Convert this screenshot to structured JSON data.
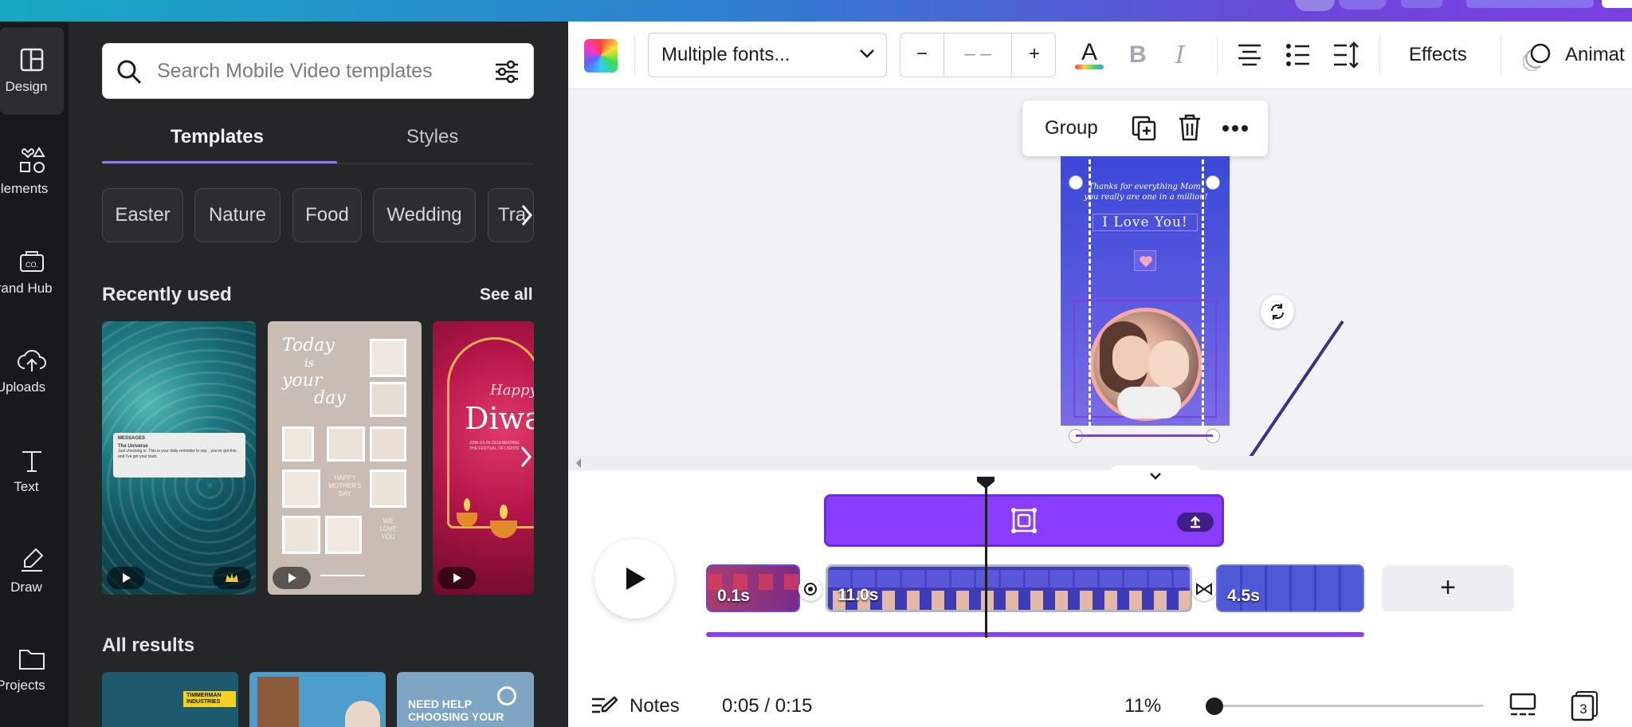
{
  "rail": [
    {
      "label": "Design",
      "icon": "design-icon"
    },
    {
      "label": "Elements",
      "icon": "elements-icon"
    },
    {
      "label": "Brand Hub",
      "icon": "brand-hub-icon"
    },
    {
      "label": "Uploads",
      "icon": "upload-icon"
    },
    {
      "label": "Text",
      "icon": "text-icon"
    },
    {
      "label": "Draw",
      "icon": "draw-icon"
    },
    {
      "label": "Projects",
      "icon": "folder-icon"
    }
  ],
  "search": {
    "placeholder": "Search Mobile Video templates"
  },
  "tabs": {
    "templates": "Templates",
    "styles": "Styles"
  },
  "chips": [
    "Easter",
    "Nature",
    "Food",
    "Wedding",
    "Tra"
  ],
  "recently_used": {
    "title": "Recently used",
    "see_all": "See all"
  },
  "templates": {
    "t1": {
      "badge": "MESSAGES",
      "name": "The Universe",
      "body": "Just checking in. This is your daily reminder to say... you've got this, and I've got your back."
    },
    "t2": {
      "line1": "Today",
      "line2": "is",
      "line3": "your",
      "line4": "day",
      "mid1": "HAPPY",
      "mid2": "MOTHER'S",
      "mid3": "DAY",
      "end1": "WE",
      "end2": "LOVE",
      "end3": "YOU"
    },
    "t3": {
      "happy": "Happy",
      "title": "Diwa",
      "sub": "JOIN US IN CELEBRATING THE FESTIVAL OF LIGHTS"
    }
  },
  "all_results": {
    "title": "All results",
    "r1_brand": "TIMMERMAN INDUSTRIES",
    "r3_text_1": "NEED HELP",
    "r3_text_2": "CHOOSING YOUR"
  },
  "toolbar": {
    "font": "Multiple fonts...",
    "size_minus": "−",
    "size_value": "– –",
    "size_plus": "+",
    "text_color_glyph": "A",
    "bold": "B",
    "italic": "I",
    "effects": "Effects",
    "animate": "Animat",
    "colors": {
      "text_underline": "#e23b6a",
      "accent": "#8b3dff"
    }
  },
  "group_popup": {
    "label": "Group"
  },
  "design": {
    "line1": "Thanks for everything Mom,",
    "line2": "you really are one in a million!",
    "headline": "I Love You!"
  },
  "timeline": {
    "clips": [
      {
        "label": "0.1s"
      },
      {
        "label": "11.0s"
      },
      {
        "label": "4.5s"
      }
    ],
    "add": "+",
    "time": "0:05 / 0:15",
    "notes": "Notes",
    "zoom": "11%",
    "pages": "3"
  }
}
